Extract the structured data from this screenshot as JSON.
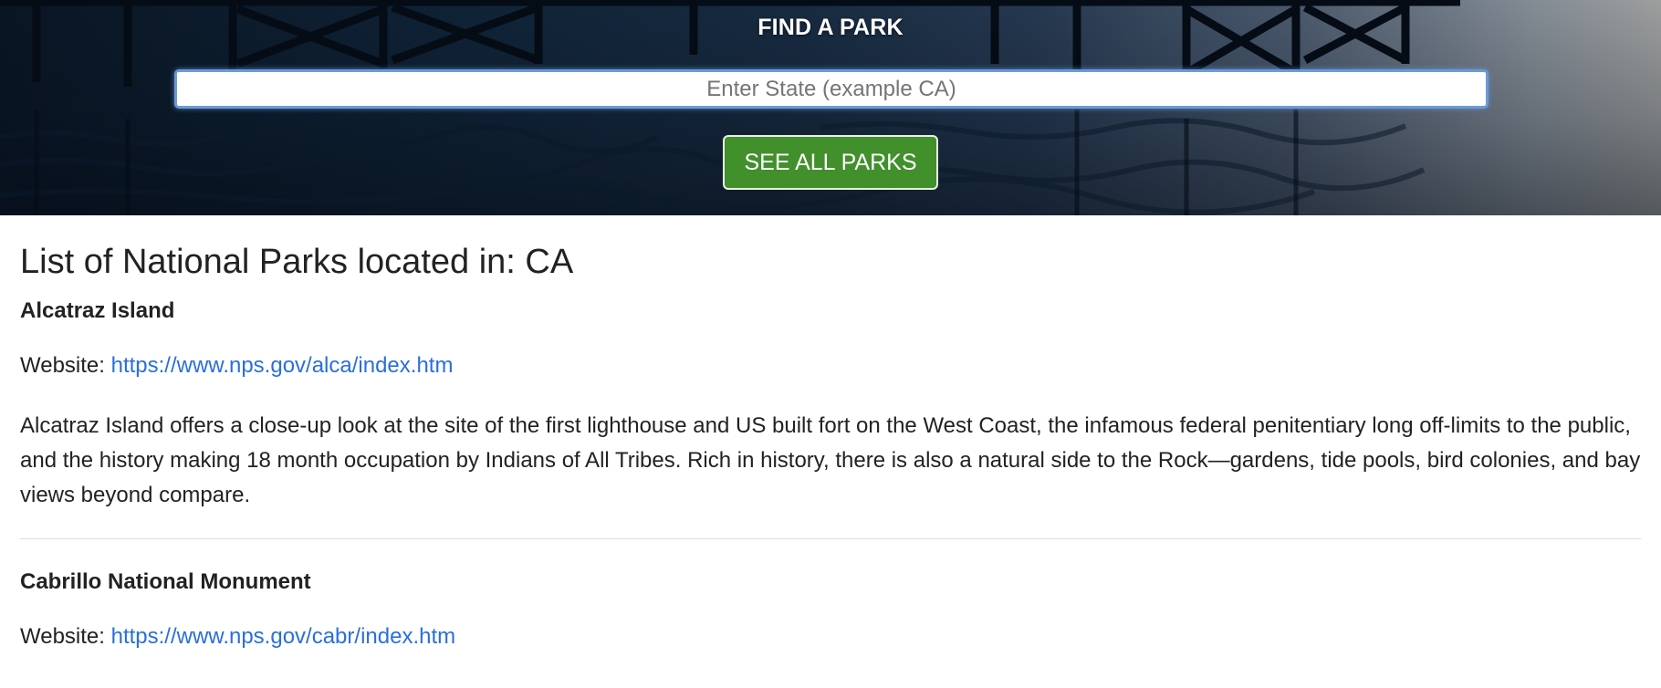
{
  "hero": {
    "title": "FIND A PARK",
    "search_placeholder": "Enter State (example CA)",
    "search_value": "",
    "see_all_label": "SEE ALL PARKS"
  },
  "list": {
    "heading": "List of National Parks located in: CA",
    "website_label": "Website:",
    "parks": [
      {
        "name": "Alcatraz Island",
        "url": "https://www.nps.gov/alca/index.htm",
        "description": "Alcatraz Island offers a close-up look at the site of the first lighthouse and US built fort on the West Coast, the infamous federal penitentiary long off-limits to the public, and the history making 18 month occupation by Indians of All Tribes. Rich in history, there is also a natural side to the Rock—gardens, tide pools, bird colonies, and bay views beyond compare."
      },
      {
        "name": "Cabrillo National Monument",
        "url": "https://www.nps.gov/cabr/index.htm",
        "description": ""
      }
    ]
  },
  "colors": {
    "button_green": "#41902b",
    "link_blue": "#2a6fdb",
    "input_focus": "#6c9ad6"
  }
}
